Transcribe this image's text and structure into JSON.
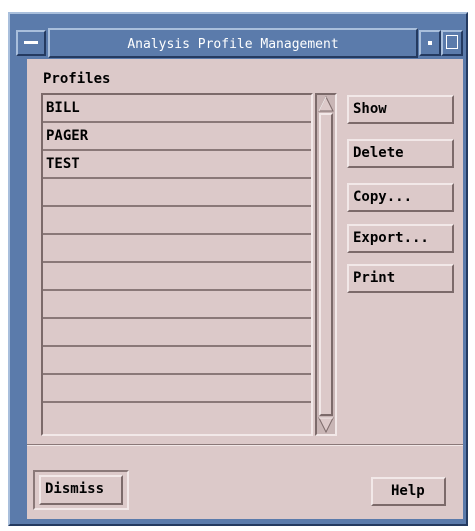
{
  "window": {
    "title": "Analysis Profile Management"
  },
  "profiles": {
    "label": "Profiles",
    "items": [
      "BILL",
      "PAGER",
      "TEST",
      "",
      "",
      "",
      "",
      "",
      "",
      "",
      "",
      ""
    ]
  },
  "actions": {
    "show": "Show",
    "delete": "Delete",
    "copy": "Copy...",
    "export": "Export...",
    "print": "Print"
  },
  "footer": {
    "dismiss": "Dismiss",
    "help": "Help"
  },
  "icons": {
    "window_menu": "window-menu-icon",
    "minimize": "minimize-icon",
    "maximize": "maximize-icon",
    "scroll_up": "scroll-up-arrow-icon",
    "scroll_down": "scroll-down-arrow-icon"
  },
  "colors": {
    "titlebar": "#5b7bab",
    "panel": "#dcc9c9"
  }
}
